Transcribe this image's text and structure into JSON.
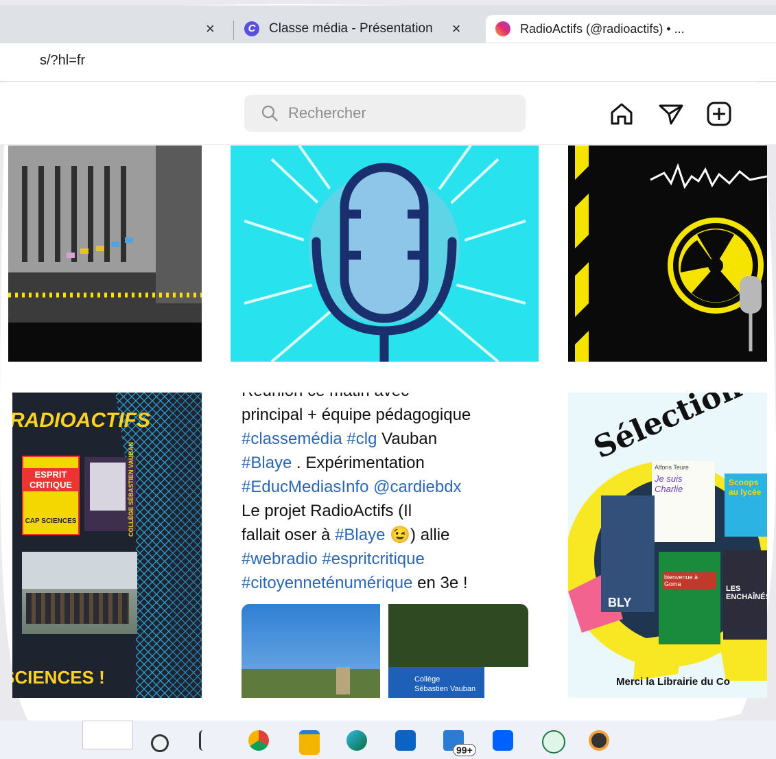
{
  "tabs": [
    {
      "title": "Classe média - Présentation",
      "active": false
    },
    {
      "title": "RadioActifs (@radioactifs) • ...",
      "active": true
    }
  ],
  "address": {
    "url": "s/?hl=fr"
  },
  "header": {
    "search_placeholder": "Rechercher"
  },
  "posts": {
    "radioactifs_title": "RADIOACTIFS",
    "esprit_critique": "ESPRIT CRITIQUE",
    "cap_sciences": "CAP SCIENCES",
    "sciences_footer": "SCIENCES !",
    "college_vertical": "COLLÈGE SÉBASTIEN VAUBAN",
    "tweet_top": "Réunion ce matin avec",
    "tweet_l1": "principal + équipe pédagogique",
    "tweet_l2_tag1": "#classemédia",
    "tweet_l2_tag2": "#clg",
    "tweet_l2_rest": " Vauban",
    "tweet_l3_tag": "#Blaye",
    "tweet_l3_rest": " . Expérimentation",
    "tweet_l4": "#EducMediasInfo @cardiebdx",
    "tweet_l5": "Le projet RadioActifs (Il",
    "tweet_l6_a": "fallait oser à ",
    "tweet_l6_tag": "#Blaye",
    "tweet_l6_emoji": "😉",
    "tweet_l6_b": ") allie",
    "tweet_l7": "#webradio #espritcritique",
    "tweet_l8_tag": "#citoyenneténumérique",
    "tweet_l8_rest": "  en 3e !",
    "college_sign_1": "Collège",
    "college_sign_2": "Sébastien Vauban",
    "selection_title": "Sélection M",
    "selection_footer": "Merci la Librairie du Co",
    "book_scoops": "Scoops au lycée",
    "book_enchaines": "LES ENCHAÎNÉS",
    "book_goma": "bienvenue à Goma",
    "book_bly": "BLY",
    "book_je_suis": "Je suis Charlie",
    "book_author": "Alfons Teure"
  },
  "taskbar": {
    "mail_badge": "99+"
  }
}
